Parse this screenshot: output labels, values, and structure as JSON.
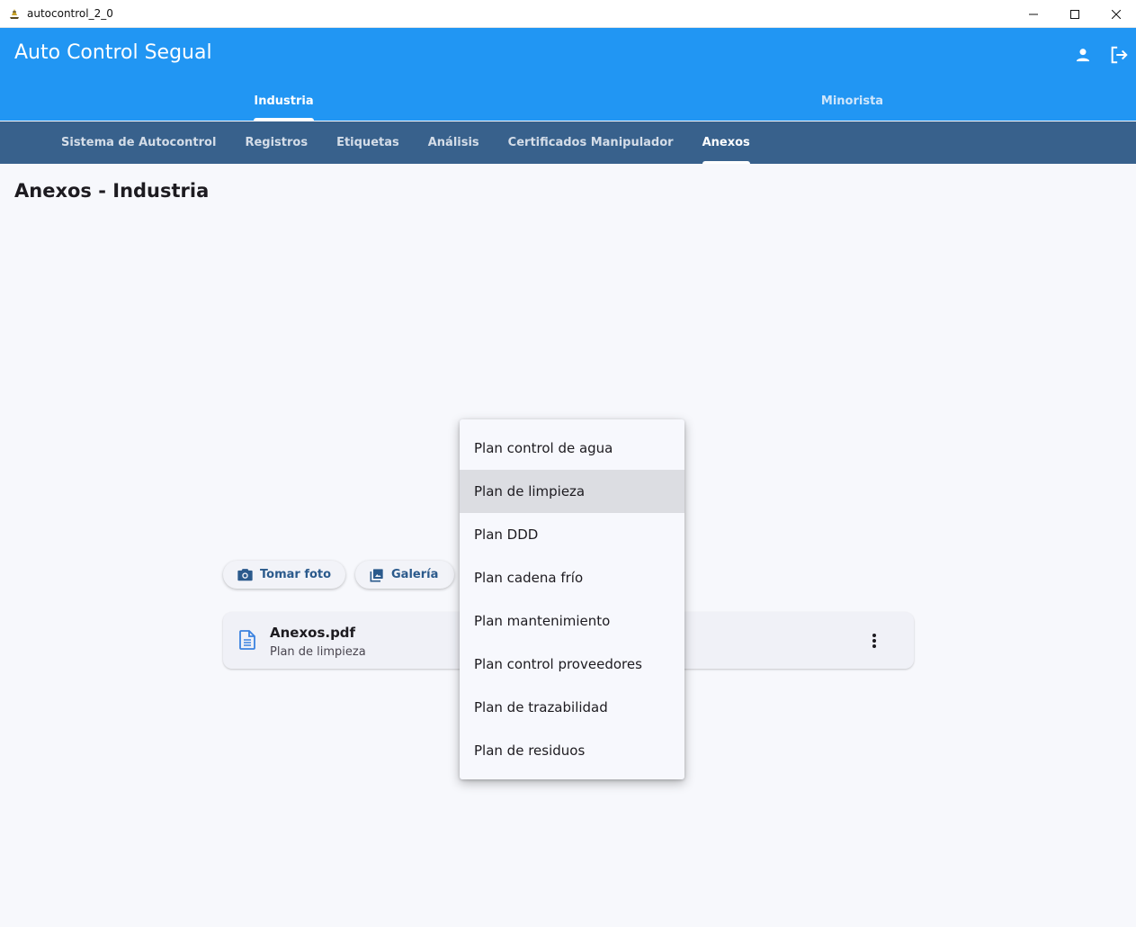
{
  "window": {
    "title": "autocontrol_2_0"
  },
  "appbar": {
    "title": "Auto Control Segual",
    "tabs": [
      {
        "label": "Industria",
        "active": true
      },
      {
        "label": "Minorista",
        "active": false
      }
    ],
    "icons": [
      "person-icon",
      "logout-icon"
    ]
  },
  "subtabs": [
    {
      "label": "Sistema de Autocontrol",
      "active": false
    },
    {
      "label": "Registros",
      "active": false
    },
    {
      "label": "Etiquetas",
      "active": false
    },
    {
      "label": "Análisis",
      "active": false
    },
    {
      "label": "Certificados Manipulador",
      "active": false
    },
    {
      "label": "Anexos",
      "active": true
    }
  ],
  "page": {
    "title": "Anexos - Industria"
  },
  "actions": {
    "take_photo": {
      "label": "Tomar foto",
      "icon": "camera-icon"
    },
    "gallery": {
      "label": "Galería",
      "icon": "gallery-icon"
    }
  },
  "file": {
    "name": "Anexos.pdf",
    "category": "Plan de limpieza",
    "icon": "document-icon"
  },
  "menu": {
    "items": [
      "Plan control de agua",
      "Plan de limpieza",
      "Plan DDD",
      "Plan cadena frío",
      "Plan mantenimiento",
      "Plan control proveedores",
      "Plan de trazabilidad",
      "Plan de residuos"
    ],
    "highlighted": "Plan de limpieza"
  },
  "colors": {
    "appbar": "#2196f3",
    "subtabs": "#38618c",
    "accent": "#2b5a8c"
  }
}
